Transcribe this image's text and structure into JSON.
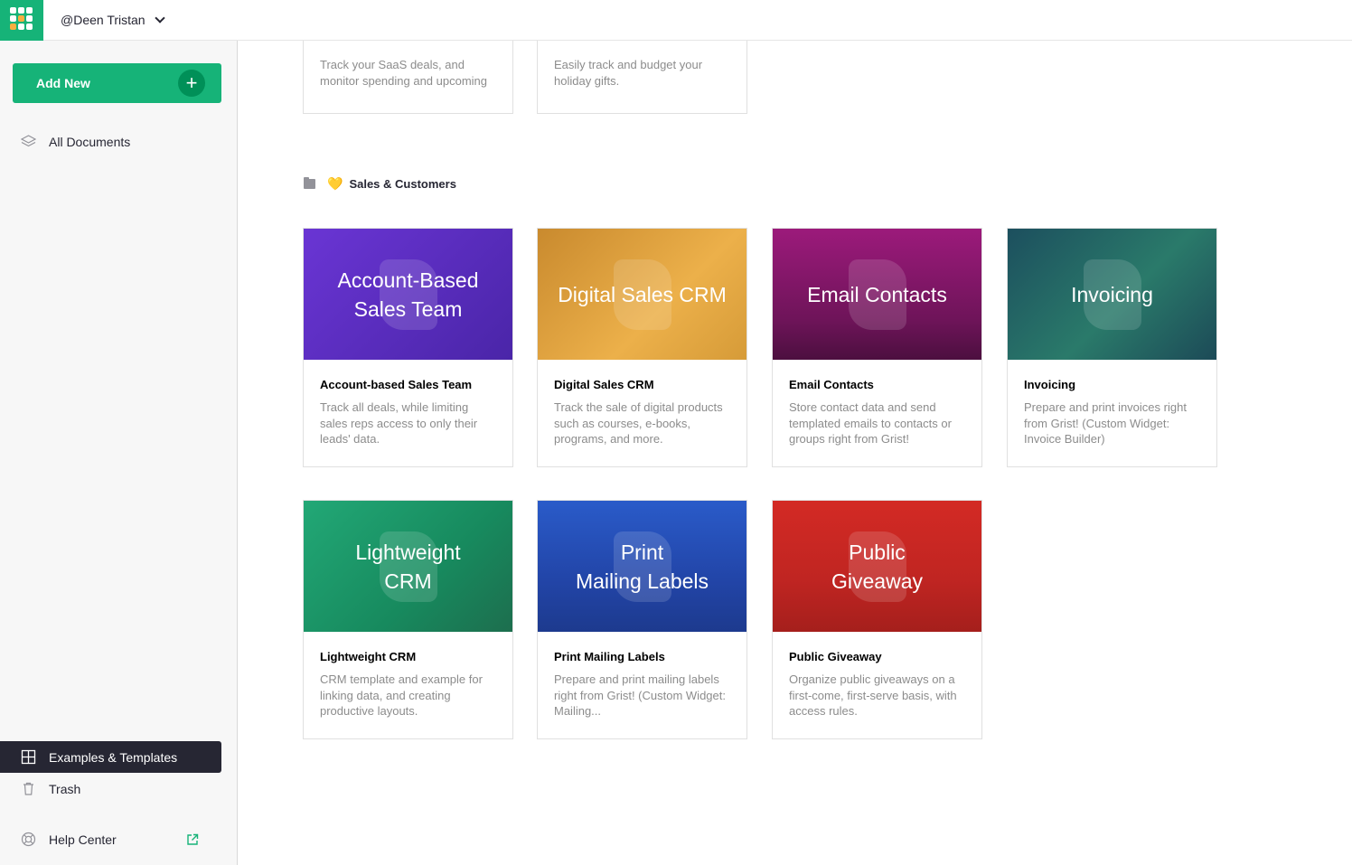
{
  "app": {
    "org_name": "@Deen Tristan",
    "add_new_label": "Add New",
    "colors": {
      "brand": "#16b378",
      "nav_active_bg": "#262633"
    }
  },
  "sidebar": {
    "all_documents": "All Documents",
    "examples_templates": "Examples & Templates",
    "trash": "Trash",
    "help_center": "Help Center"
  },
  "top_cards": [
    {
      "desc": "Track your SaaS deals, and monitor spending and upcoming expirations."
    },
    {
      "desc": "Easily track and budget your holiday gifts."
    }
  ],
  "section": {
    "emoji": "💛",
    "title": "Sales & Customers"
  },
  "cards": [
    {
      "thumb_text": "Account-Based\nSales Team",
      "title": "Account-based Sales Team",
      "desc": "Track all deals, while limiting sales reps access to only their leads' data.",
      "color": "#5b2fbf"
    },
    {
      "thumb_text": "Digital Sales CRM",
      "title": "Digital Sales CRM",
      "desc": "Track the sale of digital products such as courses, e-books, programs, and more.",
      "color": "#e3a53d"
    },
    {
      "thumb_text": "Email Contacts",
      "title": "Email Contacts",
      "desc": "Store contact data and send templated emails to contacts or groups right from Grist!",
      "color": "#8a1a6f"
    },
    {
      "thumb_text": "Invoicing",
      "title": "Invoicing",
      "desc": "Prepare and print invoices right from Grist! (Custom Widget: Invoice Builder)",
      "color": "#1f5a63"
    },
    {
      "thumb_text": "Lightweight\nCRM",
      "title": "Lightweight CRM",
      "desc": "CRM template and example for linking data, and creating productive layouts.",
      "color": "#1d9a6a"
    },
    {
      "thumb_text": "Print\nMailing Labels",
      "title": "Print Mailing Labels",
      "desc": "Prepare and print mailing labels right from Grist! (Custom Widget: Mailing...",
      "color": "#2448b0"
    },
    {
      "thumb_text": "Public\nGiveaway",
      "title": "Public Giveaway",
      "desc": "Organize public giveaways on a first-come, first-serve basis, with access rules.",
      "color": "#c42a25"
    }
  ]
}
